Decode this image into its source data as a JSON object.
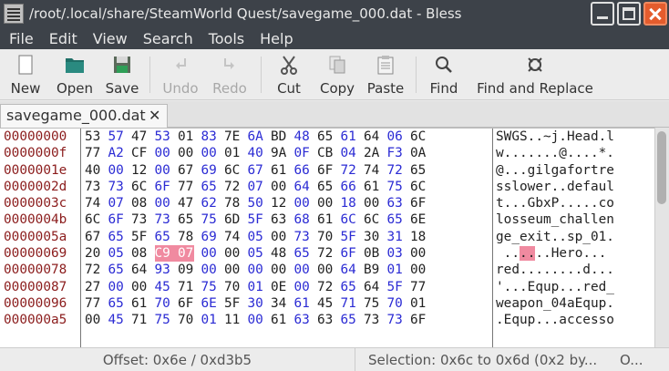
{
  "window": {
    "title": "/root/.local/share/SteamWorld Quest/savegame_000.dat - Bless"
  },
  "menu": [
    "File",
    "Edit",
    "View",
    "Search",
    "Tools",
    "Help"
  ],
  "toolbar": {
    "new": "New",
    "open": "Open",
    "save": "Save",
    "undo": "Undo",
    "redo": "Redo",
    "cut": "Cut",
    "copy": "Copy",
    "paste": "Paste",
    "find": "Find",
    "find_replace": "Find and Replace"
  },
  "tab": {
    "label": "savegame_000.dat"
  },
  "hex": {
    "addresses": [
      "00000000",
      "0000000f",
      "0000001e",
      "0000002d",
      "0000003c",
      "0000004b",
      "0000005a",
      "00000069",
      "00000078",
      "00000087",
      "00000096",
      "000000a5"
    ],
    "rows": [
      [
        "53",
        "57",
        "47",
        "53",
        "01",
        "83",
        "7E",
        "6A",
        "BD",
        "48",
        "65",
        "61",
        "64",
        "06",
        "6C"
      ],
      [
        "77",
        "A2",
        "CF",
        "00",
        "00",
        "00",
        "01",
        "40",
        "9A",
        "0F",
        "CB",
        "04",
        "2A",
        "F3",
        "0A"
      ],
      [
        "40",
        "00",
        "12",
        "00",
        "67",
        "69",
        "6C",
        "67",
        "61",
        "66",
        "6F",
        "72",
        "74",
        "72",
        "65"
      ],
      [
        "73",
        "73",
        "6C",
        "6F",
        "77",
        "65",
        "72",
        "07",
        "00",
        "64",
        "65",
        "66",
        "61",
        "75",
        "6C"
      ],
      [
        "74",
        "07",
        "08",
        "00",
        "47",
        "62",
        "78",
        "50",
        "12",
        "00",
        "00",
        "18",
        "00",
        "63",
        "6F"
      ],
      [
        "6C",
        "6F",
        "73",
        "73",
        "65",
        "75",
        "6D",
        "5F",
        "63",
        "68",
        "61",
        "6C",
        "6C",
        "65",
        "6E"
      ],
      [
        "67",
        "65",
        "5F",
        "65",
        "78",
        "69",
        "74",
        "05",
        "00",
        "73",
        "70",
        "5F",
        "30",
        "31",
        "18"
      ],
      [
        "20",
        "05",
        "08",
        "C9",
        "07",
        "00",
        "00",
        "05",
        "48",
        "65",
        "72",
        "6F",
        "0B",
        "03",
        "00"
      ],
      [
        "72",
        "65",
        "64",
        "93",
        "09",
        "00",
        "00",
        "00",
        "00",
        "00",
        "00",
        "64",
        "B9",
        "01",
        "00"
      ],
      [
        "27",
        "00",
        "00",
        "45",
        "71",
        "75",
        "70",
        "01",
        "0E",
        "00",
        "72",
        "65",
        "64",
        "5F",
        "77"
      ],
      [
        "77",
        "65",
        "61",
        "70",
        "6F",
        "6E",
        "5F",
        "30",
        "34",
        "61",
        "45",
        "71",
        "75",
        "70",
        "01"
      ],
      [
        "00",
        "45",
        "71",
        "75",
        "70",
        "01",
        "11",
        "00",
        "61",
        "63",
        "63",
        "65",
        "73",
        "73",
        "6F"
      ]
    ],
    "blue_mask": [
      [
        0,
        1,
        0,
        1,
        0,
        1,
        0,
        1,
        0,
        1,
        0,
        1,
        0,
        1,
        0
      ],
      [
        0,
        1,
        0,
        1,
        0,
        1,
        0,
        1,
        0,
        1,
        0,
        1,
        0,
        1,
        0
      ],
      [
        0,
        1,
        0,
        1,
        0,
        1,
        0,
        1,
        0,
        1,
        0,
        1,
        0,
        1,
        0
      ],
      [
        0,
        1,
        0,
        1,
        0,
        1,
        0,
        1,
        0,
        1,
        0,
        1,
        0,
        1,
        0
      ],
      [
        0,
        1,
        0,
        1,
        0,
        1,
        0,
        1,
        0,
        1,
        0,
        1,
        0,
        1,
        0
      ],
      [
        0,
        1,
        0,
        1,
        0,
        1,
        0,
        1,
        0,
        1,
        0,
        1,
        0,
        1,
        0
      ],
      [
        0,
        1,
        0,
        1,
        0,
        1,
        0,
        1,
        0,
        1,
        0,
        1,
        0,
        1,
        0
      ],
      [
        0,
        1,
        0,
        1,
        0,
        1,
        0,
        1,
        0,
        1,
        0,
        1,
        0,
        1,
        0
      ],
      [
        0,
        1,
        0,
        1,
        0,
        1,
        0,
        1,
        0,
        1,
        0,
        1,
        0,
        1,
        0
      ],
      [
        0,
        1,
        0,
        1,
        0,
        1,
        0,
        1,
        0,
        1,
        0,
        1,
        0,
        1,
        0
      ],
      [
        0,
        1,
        0,
        1,
        0,
        1,
        0,
        1,
        0,
        1,
        0,
        1,
        0,
        1,
        0
      ],
      [
        0,
        1,
        0,
        1,
        0,
        1,
        0,
        1,
        0,
        1,
        0,
        1,
        0,
        1,
        0
      ]
    ],
    "selection": {
      "row": 7,
      "cols": [
        3,
        4
      ]
    },
    "text_rows": [
      "SWGS..~j.Head.l",
      "w.......@....*.",
      "@...gilgafortre",
      "sslower..defaul",
      "t...GbxP.....co",
      "losseum_challen",
      "ge_exit..sp_01.",
      " ......Hero...",
      "red........d...",
      "'...Equp...red_",
      "weapon_04aEqup.",
      ".Equp...accesso"
    ]
  },
  "status": {
    "offset": "Offset: 0x6e / 0xd3b5",
    "selection": "Selection: 0x6c to 0x6d (0x2 by...",
    "mode": "O..."
  },
  "colors": {
    "titlebar": "#3d4249",
    "address": "#8b1c1c",
    "hex_blue": "#2b2bd4",
    "selection": "#f08aa0"
  }
}
